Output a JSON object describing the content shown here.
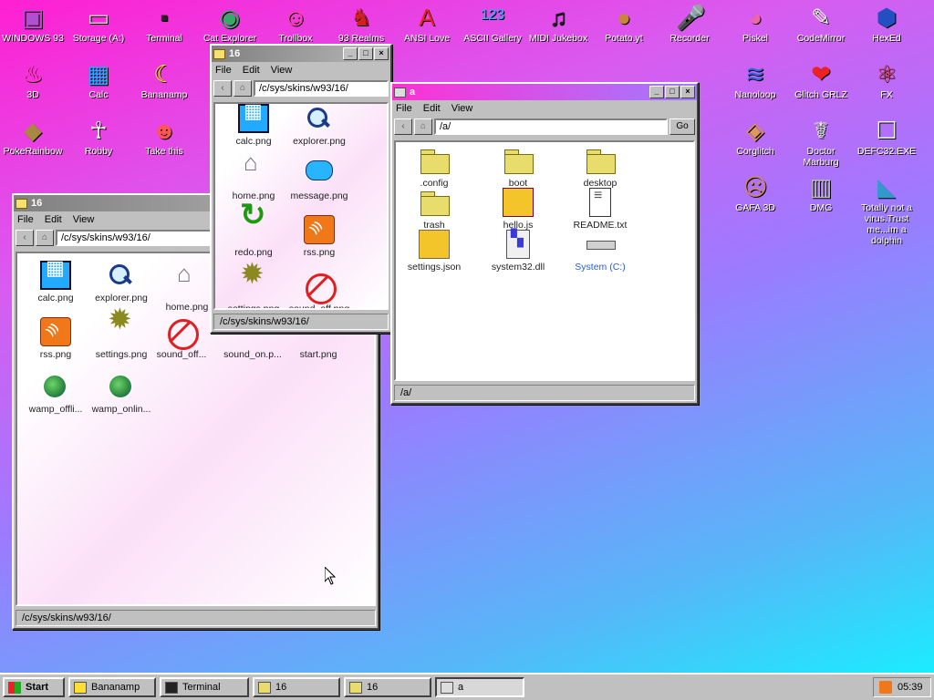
{
  "desktop_icons": [
    {
      "label": "WINDOWS 93",
      "icon": "computer-icon",
      "color": "#b050d0"
    },
    {
      "label": "Storage (A:)",
      "icon": "floppy-drive-icon",
      "color": "#d0d0d0"
    },
    {
      "label": "Terminal",
      "icon": "terminal-icon",
      "color": "#222"
    },
    {
      "label": "Cat Explorer",
      "icon": "cat-globe-icon",
      "color": "#3a6"
    },
    {
      "label": "Trollbox",
      "icon": "troll-face-icon",
      "color": "#f48"
    },
    {
      "label": "93 Realms",
      "icon": "realms-icon",
      "color": "#c22"
    },
    {
      "label": "ANSI Love",
      "icon": "ansi-letter-icon",
      "color": "#e22"
    },
    {
      "label": "ASCII Gallery",
      "icon": "ascii-numbers-icon",
      "color": "#3af"
    },
    {
      "label": "MIDI Jukebox",
      "icon": "piano-icon",
      "color": "#222"
    },
    {
      "label": "Potato.yt",
      "icon": "potato-icon",
      "color": "#c8863a"
    },
    {
      "label": "Recorder",
      "icon": "microphone-icon",
      "color": "#ccc"
    },
    {
      "label": "Piskel",
      "icon": "palette-icon",
      "color": "#e6a"
    },
    {
      "label": "CodeMirror",
      "icon": "codemirror-icon",
      "color": "#fff"
    },
    {
      "label": "HexEd",
      "icon": "hex-cube-icon",
      "color": "#2250c0"
    },
    {
      "label": "3D",
      "icon": "teapot-icon",
      "color": "#f4a"
    },
    {
      "label": "Calc",
      "icon": "calculator-icon",
      "color": "#2af"
    },
    {
      "label": "Bananamp",
      "icon": "banana-icon",
      "color": "#ff0"
    },
    {
      "label": "Nanoloop",
      "icon": "nanoloop-icon",
      "color": "#36d"
    },
    {
      "label": "Glitch GRLZ",
      "icon": "lips-icon",
      "color": "#e22"
    },
    {
      "label": "FX",
      "icon": "atom-icon",
      "color": "#c33"
    },
    {
      "label": "PokeRainbow",
      "icon": "pokemon-icon",
      "color": "#a84"
    },
    {
      "label": "Robby",
      "icon": "stick-figure-icon",
      "color": "#fff"
    },
    {
      "label": "Take this",
      "icon": "pixel-man-icon",
      "color": "#f55"
    },
    {
      "label": "Corglitch",
      "icon": "corgi-icon",
      "color": "#d95"
    },
    {
      "label": "Doctor Marburg",
      "icon": "doctor-icon",
      "color": "#eee"
    },
    {
      "label": "DEFC32.EXE",
      "icon": "monitor-face-icon",
      "color": "#fff"
    },
    {
      "label": "GAFA 3D",
      "icon": "face-3d-icon",
      "color": "#c86"
    },
    {
      "label": "DMG",
      "icon": "gameboy-icon",
      "color": "#bbb"
    },
    {
      "label": "Totally not a virus.Trust me...im a dolphin",
      "icon": "dolphin-icon",
      "color": "#39c"
    }
  ],
  "windows": {
    "back": {
      "title": "16",
      "menu": [
        "File",
        "Edit",
        "View"
      ],
      "address": "/c/sys/skins/w93/16/",
      "status": "/c/sys/skins/w93/16/",
      "files": [
        {
          "label": "calc.png",
          "icon": "calc"
        },
        {
          "label": "explorer.png",
          "icon": "search"
        },
        {
          "label": "home.png",
          "icon": "home"
        },
        {
          "label": "rss.png",
          "icon": "rss"
        },
        {
          "label": "settings.png",
          "icon": "gear"
        },
        {
          "label": "sound_off...",
          "icon": "nosound"
        },
        {
          "label": "sound_on.p...",
          "icon": "gear"
        },
        {
          "label": "start.png",
          "icon": "home"
        },
        {
          "label": "wamp_offli...",
          "icon": "globe"
        },
        {
          "label": "wamp_onlin...",
          "icon": "globe"
        }
      ]
    },
    "middle": {
      "title": "16",
      "menu": [
        "File",
        "Edit",
        "View"
      ],
      "address": "/c/sys/skins/w93/16/",
      "status": "/c/sys/skins/w93/16/",
      "files": [
        {
          "label": "calc.png",
          "icon": "calc"
        },
        {
          "label": "explorer.png",
          "icon": "search"
        },
        {
          "label": "home.png",
          "icon": "home"
        },
        {
          "label": "message.png",
          "icon": "msg"
        },
        {
          "label": "redo.png",
          "icon": "redo"
        },
        {
          "label": "rss.png",
          "icon": "rss"
        },
        {
          "label": "settings.png",
          "icon": "gear"
        },
        {
          "label": "sound_off.png",
          "icon": "nosound"
        }
      ]
    },
    "front": {
      "title": "a",
      "menu": [
        "File",
        "Edit",
        "View"
      ],
      "address": "/a/",
      "go_label": "Go",
      "status": "/a/",
      "files": [
        {
          "label": ".config",
          "icon": "folder"
        },
        {
          "label": "boot",
          "icon": "folder"
        },
        {
          "label": "desktop",
          "icon": "folder"
        },
        {
          "label": "trash",
          "icon": "folder"
        },
        {
          "label": "hello.js",
          "icon": "js"
        },
        {
          "label": "README.txt",
          "icon": "doc"
        },
        {
          "label": "settings.json",
          "icon": "json"
        },
        {
          "label": "system32.dll",
          "icon": "dll"
        },
        {
          "label": "System (C:)",
          "icon": "drive"
        }
      ]
    }
  },
  "taskbar": {
    "start_label": "Start",
    "items": [
      {
        "label": "Bananamp",
        "icon": "banana-icon",
        "pressed": false
      },
      {
        "label": "Terminal",
        "icon": "terminal-icon",
        "pressed": false
      },
      {
        "label": "16",
        "icon": "folder-icon",
        "pressed": false
      },
      {
        "label": "16",
        "icon": "folder-icon",
        "pressed": false
      },
      {
        "label": "a",
        "icon": "drive-icon",
        "pressed": true
      }
    ],
    "clock": "05:39"
  },
  "colors": {
    "accent": "#ff30d4",
    "accent2": "#9f7cff",
    "window_gray": "#c0c0c0"
  }
}
